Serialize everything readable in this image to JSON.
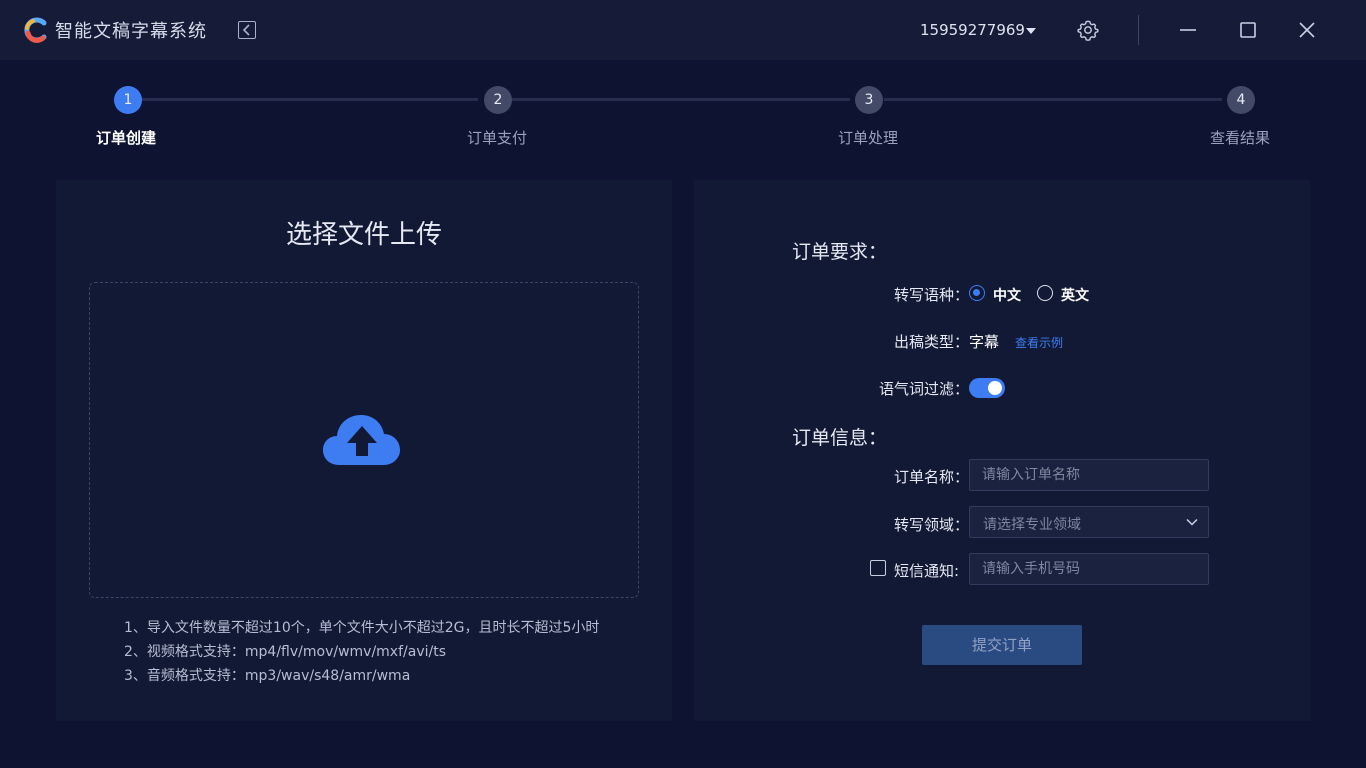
{
  "app": {
    "title": "智能文稿字幕系统"
  },
  "header": {
    "user_phone": "15959277969"
  },
  "steps": [
    {
      "num": "1",
      "label": "订单创建",
      "active": true
    },
    {
      "num": "2",
      "label": "订单支付",
      "active": false
    },
    {
      "num": "3",
      "label": "订单处理",
      "active": false
    },
    {
      "num": "4",
      "label": "查看结果",
      "active": false
    }
  ],
  "upload": {
    "title": "选择文件上传",
    "notes": [
      "1、导入文件数量不超过10个，单个文件大小不超过2G，且时长不超过5小时",
      "2、视频格式支持：mp4/flv/mov/wmv/mxf/avi/ts",
      "3、音频格式支持：mp3/wav/s48/amr/wma"
    ]
  },
  "requirements": {
    "title": "订单要求：",
    "language_label": "转写语种：",
    "language_options": [
      "中文",
      "英文"
    ],
    "language_selected": "中文",
    "output_label": "出稿类型：",
    "output_value": "字幕",
    "output_example_link": "查看示例",
    "filler_label": "语气词过滤：",
    "filler_enabled": true
  },
  "info": {
    "title": "订单信息：",
    "name_label": "订单名称：",
    "name_placeholder": "请输入订单名称",
    "domain_label": "转写领域：",
    "domain_placeholder": "请选择专业领域",
    "sms_label": "短信通知:",
    "sms_placeholder": "请输入手机号码",
    "sms_checked": false
  },
  "submit": {
    "label": "提交订单"
  },
  "colors": {
    "accent": "#3e7df1",
    "background": "#0d1330",
    "panel": "#121934"
  }
}
